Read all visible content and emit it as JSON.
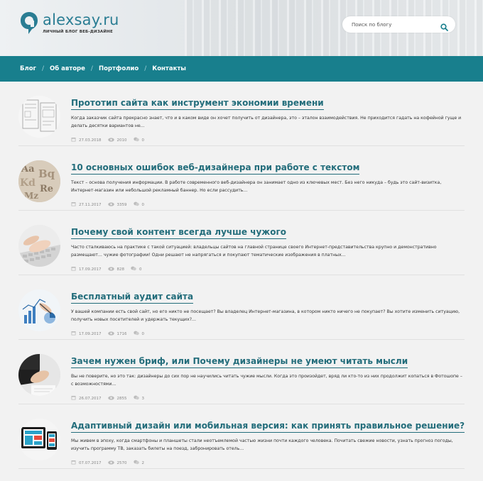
{
  "header": {
    "logo_name": "alexsay.ru",
    "logo_tagline": "ЛИЧНЫЙ БЛОГ ВЕБ-ДИЗАЙНЕ",
    "search_placeholder": "Поиск по блогу"
  },
  "nav": {
    "items": [
      {
        "label": "Блог"
      },
      {
        "label": "Об авторе"
      },
      {
        "label": "Портфолио"
      },
      {
        "label": "Контакты"
      }
    ],
    "separator": "/"
  },
  "colors": {
    "accent": "#187f8d",
    "title": "#236d7b",
    "background": "#f2f2f2"
  },
  "posts": [
    {
      "title": "Прототип сайта как инструмент экономии времени",
      "excerpt": "Когда заказчик сайта прекрасно знает, что и в каком виде он хочет получить от дизайнера, это – эталон взаимодействия. Не приходится гадать на кофейной гуще и делать десятки вариантов не...",
      "date": "27.03.2018",
      "views": "2010",
      "comments": "0",
      "thumbnail_icon": "wireframe-thumbnail"
    },
    {
      "title": "10 основных ошибок веб-дизайнера при работе с текстом",
      "excerpt": "Текст – основа получения информации. В работе современного веб-дизайнера он занимает одно из ключевых мест. Без него никуда – будь это сайт-визитка, Интернет-магазин или небольшой рекламный баннер. Но если рассудить...",
      "date": "27.11.2017",
      "views": "3359",
      "comments": "0",
      "thumbnail_icon": "letters-thumbnail"
    },
    {
      "title": "Почему свой контент всегда лучше чужого",
      "excerpt": "Часто сталкиваюсь на практике с такой ситуацией: владельцы сайтов на главной странице своего Интернет-представительства крупно и демонстративно размещают... чужие фотографии! Одни решают не напрягаться и покупают тематические изображения в платных...",
      "date": "17.09.2017",
      "views": "828",
      "comments": "0",
      "thumbnail_icon": "keyboard-thumbnail"
    },
    {
      "title": "Бесплатный аудит сайта",
      "excerpt": "У вашей компании есть свой сайт, но его никто не посещает? Вы владелец Интернет-магазина, в котором никто ничего не покупает? Вы хотите изменить ситуацию, получить новых посетителей и удержать текущих?...",
      "date": "17.09.2017",
      "views": "1716",
      "comments": "0",
      "thumbnail_icon": "charts-thumbnail"
    },
    {
      "title": "Зачем нужен бриф, или Почему дизайнеры не умеют читать мысли",
      "excerpt": "Вы не поверите, но это так: дизайнеры до сих пор не научились читать чужие мысли. Когда это произойдет, вряд ли кто-то из них продолжит копаться в Фотошопе – с возможностями...",
      "date": "26.07.2017",
      "views": "2855",
      "comments": "3",
      "thumbnail_icon": "handshake-thumbnail"
    },
    {
      "title": "Адаптивный дизайн или мобильная версия: как принять правильное решение?",
      "excerpt": "Мы живем в эпоху, когда смартфоны и планшеты стали неотъемлемой частью жизни почти каждого человека. Почитать свежие новости, узнать прогноз погоды, изучить программу ТВ, заказать билеты на поезд, забронировать отель...",
      "date": "07.07.2017",
      "views": "2570",
      "comments": "2",
      "thumbnail_icon": "devices-thumbnail"
    }
  ]
}
